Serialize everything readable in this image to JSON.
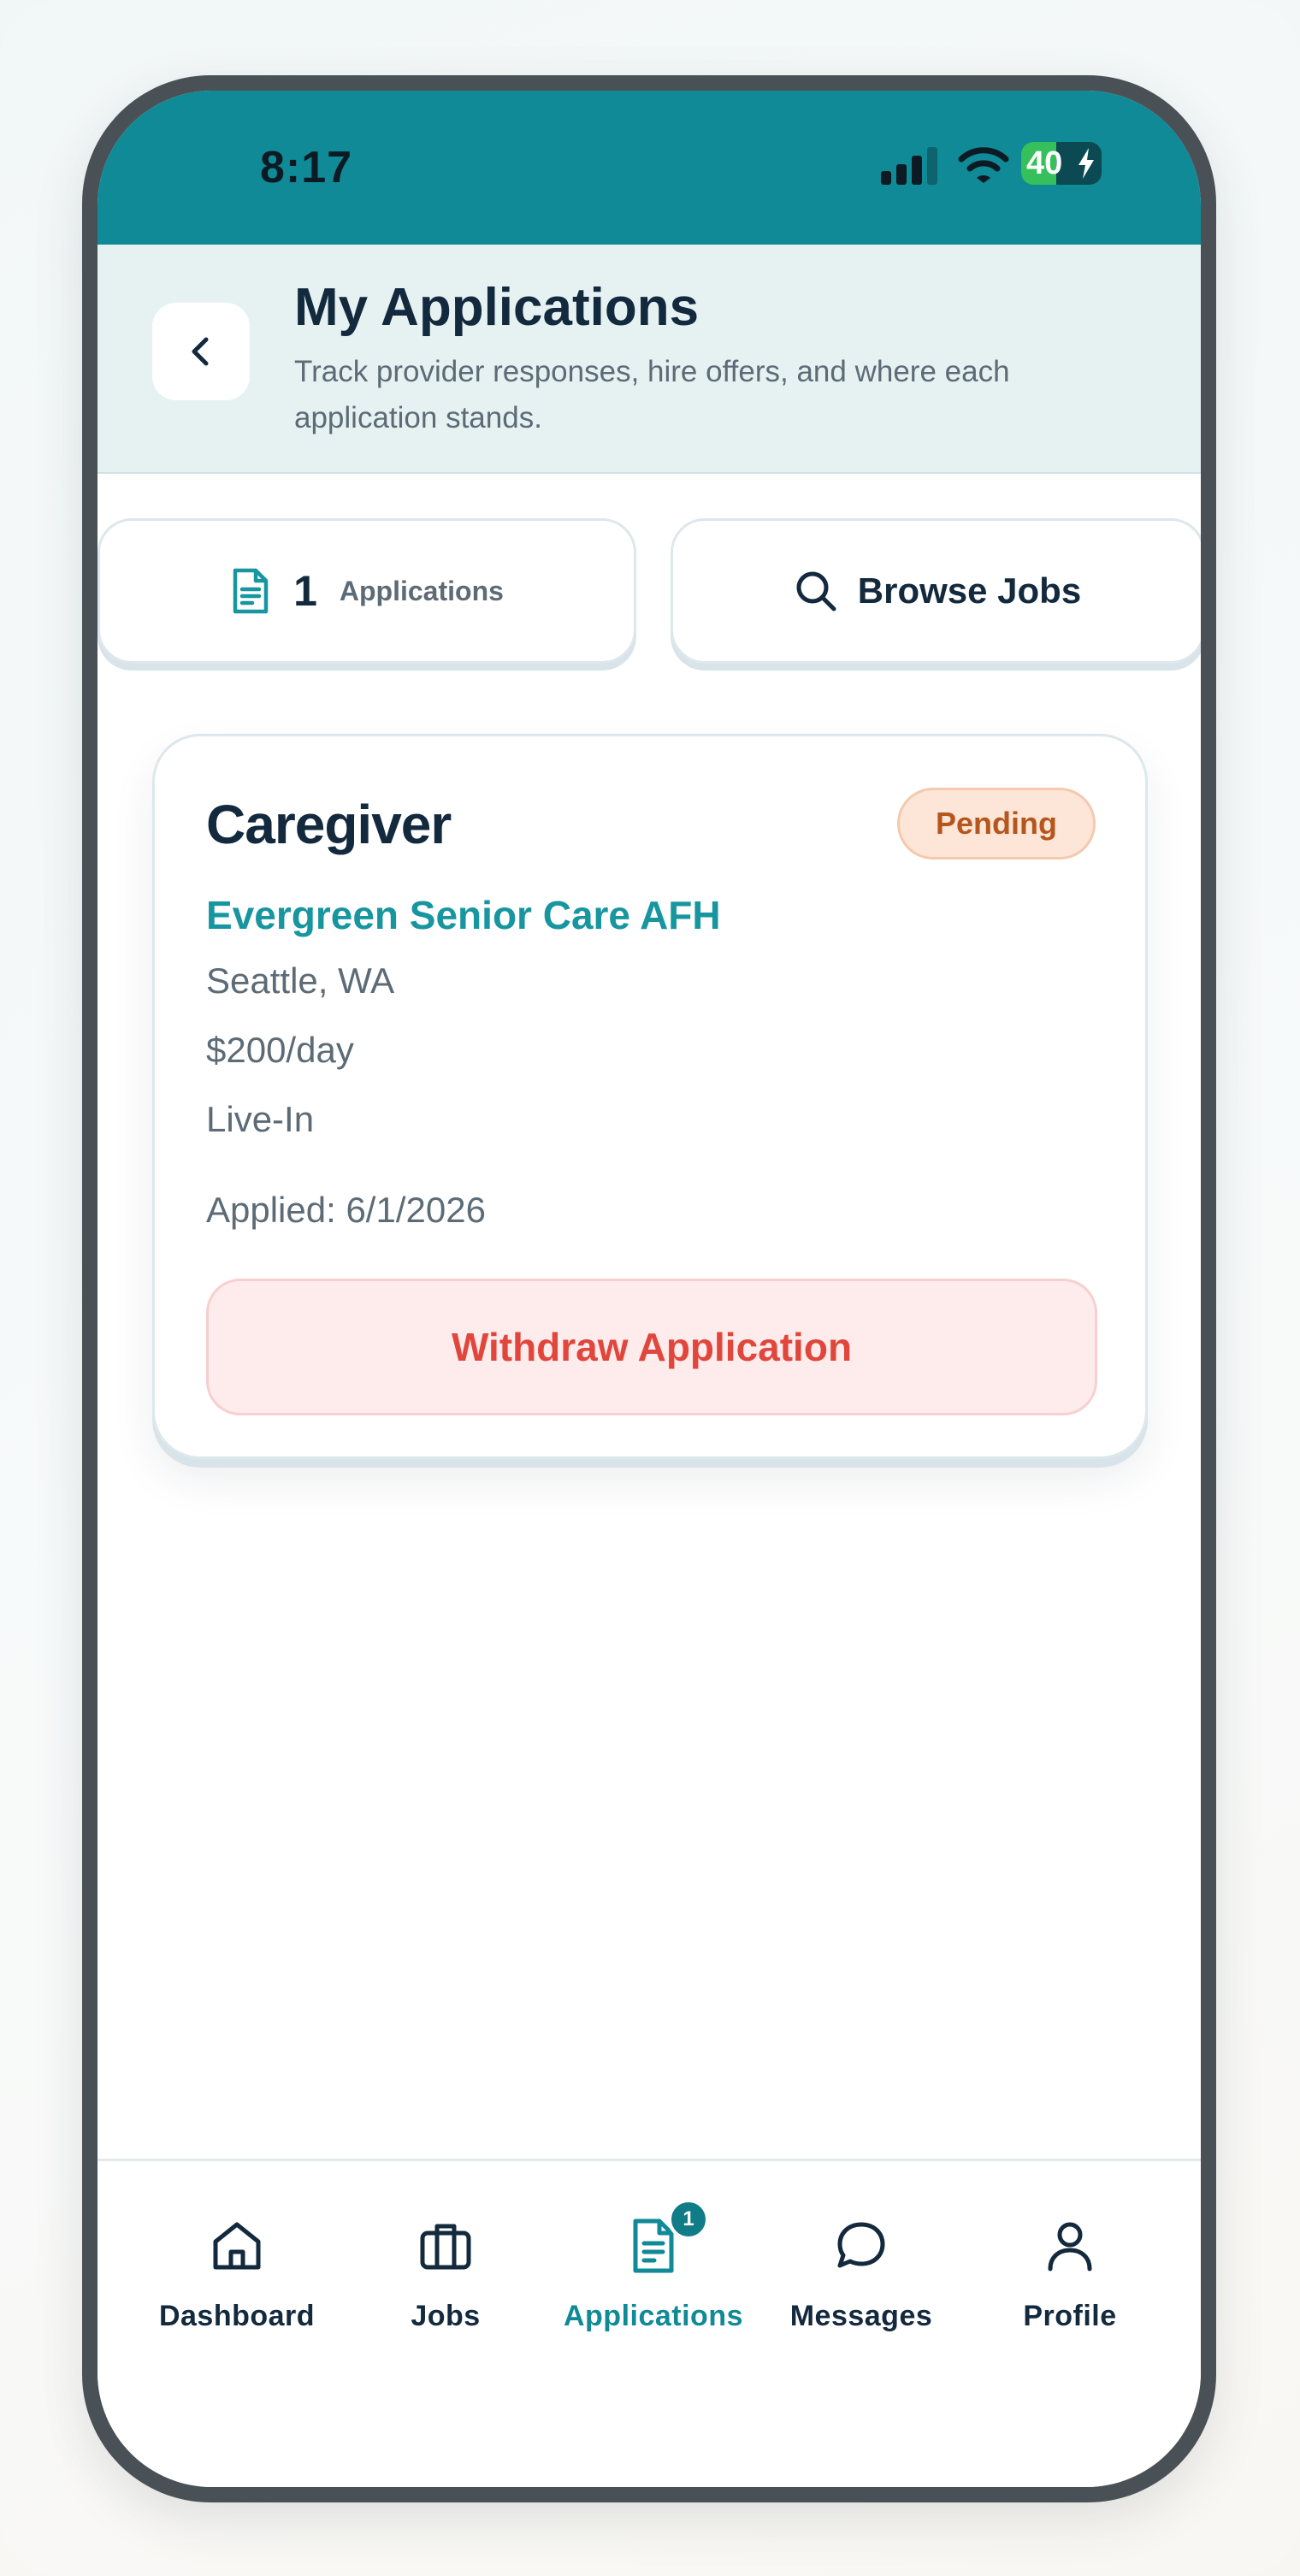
{
  "status_bar": {
    "time": "8:17",
    "battery": "40"
  },
  "header": {
    "title": "My Applications",
    "subtitle": "Track provider responses, hire offers, and where each application stands."
  },
  "summary": {
    "count": "1",
    "count_label": "Applications",
    "browse_label": "Browse Jobs"
  },
  "applications": [
    {
      "title": "Caregiver",
      "status": "Pending",
      "employer": "Evergreen Senior Care AFH",
      "location": "Seattle, WA",
      "pay": "$200/day",
      "schedule": "Live-In",
      "applied": "Applied: 6/1/2026",
      "withdraw_label": "Withdraw Application"
    }
  ],
  "bottom_nav": {
    "items": [
      {
        "label": "Dashboard",
        "icon": "home-icon"
      },
      {
        "label": "Jobs",
        "icon": "briefcase-icon"
      },
      {
        "label": "Applications",
        "icon": "document-icon",
        "badge": "1",
        "active": true
      },
      {
        "label": "Messages",
        "icon": "chat-bubble-icon"
      },
      {
        "label": "Profile",
        "icon": "user-icon"
      }
    ]
  },
  "colors": {
    "brand_teal": "#0f8a96",
    "header_bg": "#e6f2f2",
    "pending_bg": "#fde6d8",
    "pending_text": "#b5561c",
    "withdraw_text": "#e1463c",
    "title_dark": "#13293d"
  }
}
